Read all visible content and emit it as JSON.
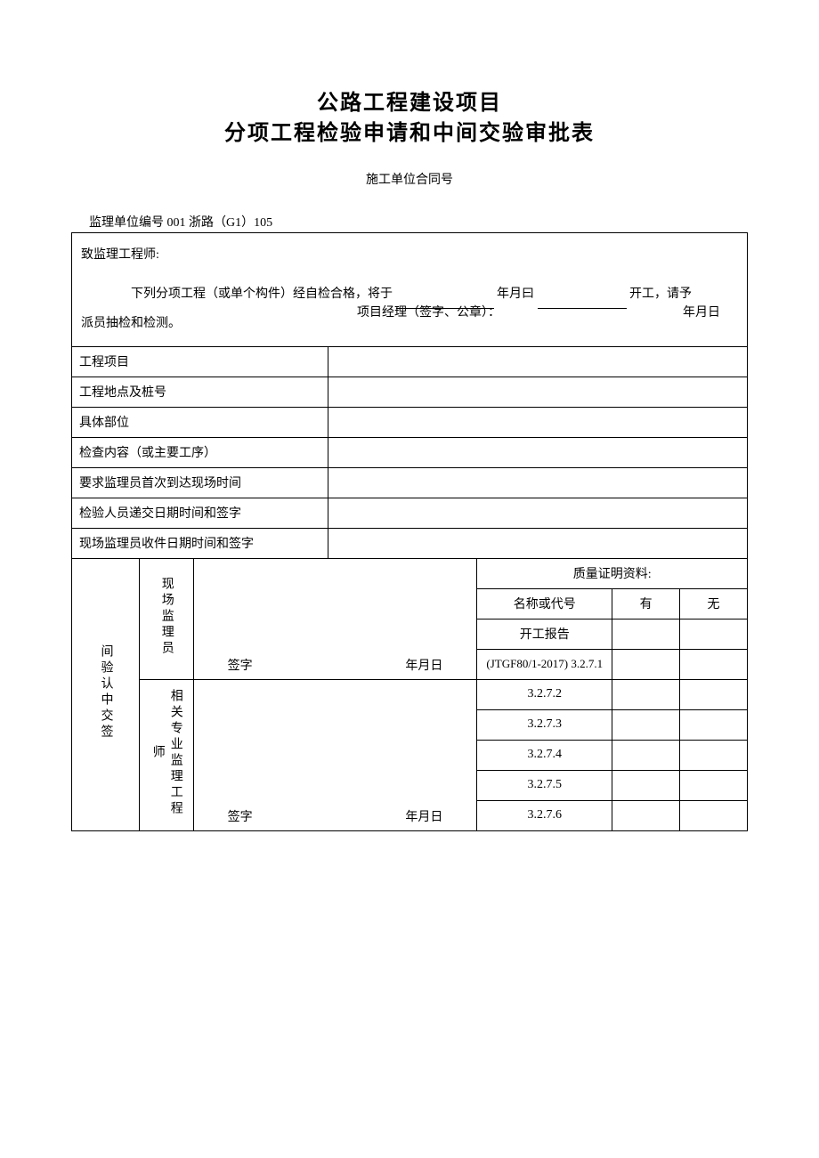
{
  "title": {
    "line1": "公路工程建设项目",
    "line2": "分项工程检验申请和中间交验审批表"
  },
  "sub_header": "施工单位合同号",
  "ref_line": "监理单位编号 001 浙路（G1）105",
  "intro": {
    "opening": "致监理工程师:",
    "body_prefix": "下列分项工程（或单个构件）经自检合格，将于",
    "date_label": "年月曰",
    "body_suffix": "开工，请予",
    "body_cont": "派员抽检和检测。",
    "pm_label": "项目经理（签字、公章）：",
    "pm_date": "年月日"
  },
  "fields": {
    "f1": "工程项目",
    "f2": "工程地点及桩号",
    "f3": "具体部位",
    "f4": "检查内容（或主要工序）",
    "f5": "要求监理员首次到达现场时间",
    "f6": "检验人员递交日期时间和签字",
    "f7": "现场监理员收件日期时间和签字"
  },
  "confirm_block": {
    "main_label": "间验认中交签",
    "role1": "现场监理员",
    "role2": "相关专业监理工程师",
    "sign_label": "签字",
    "sign_date": "年月日"
  },
  "quality": {
    "header": "质量证明资料:",
    "col_name": "名称或代号",
    "col_yes": "有",
    "col_no": "无",
    "rows": [
      "开工报告",
      "(JTGF80/1-2017) 3.2.7.1",
      "3.2.7.2",
      "3.2.7.3",
      "3.2.7.4",
      "3.2.7.5",
      "3.2.7.6"
    ]
  }
}
